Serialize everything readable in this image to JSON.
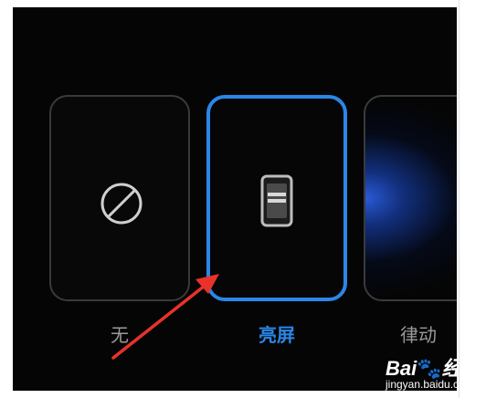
{
  "options": [
    {
      "label": "无",
      "icon": "ban-icon",
      "selected": false
    },
    {
      "label": "亮屏",
      "icon": "screen-on-icon",
      "selected": true
    },
    {
      "label": "律动",
      "icon": "rhythm-glow",
      "selected": false
    }
  ],
  "colors": {
    "accent": "#2b86e8",
    "background": "#050505",
    "card_border": "#3a3a3a",
    "label_inactive": "#9a9a9a",
    "annotation_arrow": "#e8322a"
  },
  "watermark": {
    "brand": "Bai",
    "brand_suffix": "经验",
    "url": "jingyan.baidu.com"
  }
}
